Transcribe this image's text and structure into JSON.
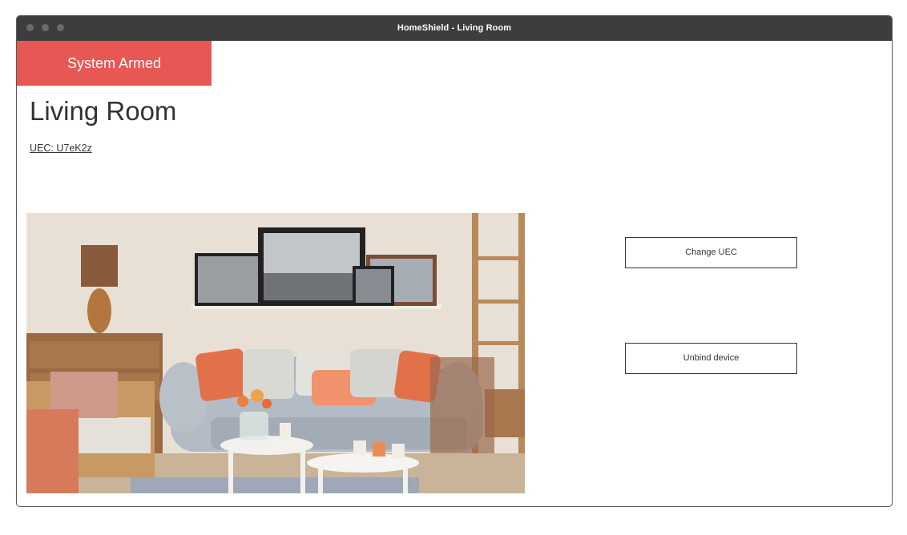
{
  "window": {
    "title": "HomeShield - Living Room"
  },
  "status": {
    "label": "System Armed",
    "color": "#e75753"
  },
  "room": {
    "name": "Living Room",
    "uec_link": "UEC: U7eK2z"
  },
  "photo": {
    "alt": "living room"
  },
  "actions": {
    "change_uec": "Change UEC",
    "unbind_device": "Unbind device"
  }
}
